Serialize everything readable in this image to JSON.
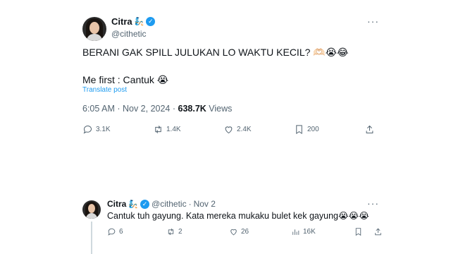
{
  "main_tweet": {
    "display_name": "Citra",
    "name_emoji": "🧞",
    "verified_mark": "✓",
    "handle": "@cithetic",
    "text_line1": "BERANI GAK SPILL JULUKAN LO WAKTU KECIL? 🫶🏻😭😂",
    "text_line2": "Me first : Cantuk 😭",
    "translate_label": "Translate post",
    "time_date": "6:05 AM · Nov 2, 2024 · ",
    "views_count": "638.7K",
    "views_label": " Views",
    "actions": {
      "replies": "3.1K",
      "reposts": "1.4K",
      "likes": "2.4K",
      "bookmarks": "200"
    },
    "more_label": "···"
  },
  "reply_tweet": {
    "display_name": "Citra",
    "name_emoji": "🧞",
    "verified_mark": "✓",
    "handle": "@cithetic",
    "separator": "·",
    "date": "Nov 2",
    "text": "Cantuk tuh gayung. Kata mereka mukaku bulet kek gayung😭😭😭",
    "actions": {
      "replies": "6",
      "reposts": "2",
      "likes": "26",
      "views": "16K"
    },
    "more_label": "···"
  },
  "icons": {
    "verified_color": "#1d9bf0",
    "link_color": "#1d9bf0",
    "muted_color": "#536471"
  }
}
